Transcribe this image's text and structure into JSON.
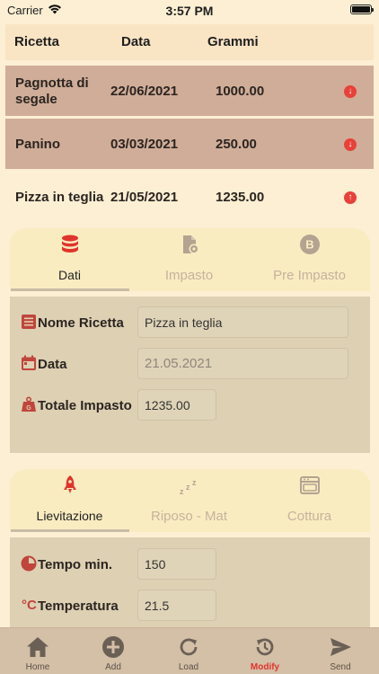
{
  "status_bar": {
    "carrier": "Carrier",
    "time": "3:57 PM"
  },
  "table": {
    "headers": {
      "recipe": "Ricetta",
      "date": "Data",
      "grams": "Grammi"
    },
    "rows": [
      {
        "name": "Pagnotta di segale",
        "date": "22/06/2021",
        "grams": "1000.00",
        "arrow": "↓"
      },
      {
        "name": "Panino",
        "date": "03/03/2021",
        "grams": "250.00",
        "arrow": "↓"
      },
      {
        "name": "Pizza in teglia",
        "date": "21/05/2021",
        "grams": "1235.00",
        "arrow": "↑"
      }
    ]
  },
  "card1": {
    "tabs": [
      {
        "label": "Dati",
        "icon": "database-icon",
        "active": true
      },
      {
        "label": "Impasto",
        "icon": "document-gear-icon",
        "active": false
      },
      {
        "label": "Pre Impasto",
        "icon": "circle-b-icon",
        "active": false
      }
    ],
    "fields": {
      "name_label": "Nome Ricetta",
      "name_value": "Pizza in teglia",
      "date_label": "Data",
      "date_value": "21.05.2021",
      "total_label": "Totale Impasto",
      "total_value": "1235.00"
    }
  },
  "card2": {
    "tabs": [
      {
        "label": "Lievitazione",
        "icon": "rocket-icon",
        "active": true
      },
      {
        "label": "Riposo - Mat",
        "icon": "zzz-icon",
        "active": false
      },
      {
        "label": "Cottura",
        "icon": "oven-icon",
        "active": false
      }
    ],
    "fields": {
      "time_label": "Tempo min.",
      "time_value": "150",
      "temp_label": "Temperatura",
      "temp_value": "21.5",
      "temp_unit_symbol": "°C"
    }
  },
  "tab_bar": {
    "items": [
      {
        "label": "Home",
        "icon": "home-icon",
        "active": false
      },
      {
        "label": "Add",
        "icon": "add-icon",
        "active": false
      },
      {
        "label": "Load",
        "icon": "load-icon",
        "active": false
      },
      {
        "label": "Modify",
        "icon": "modify-icon",
        "active": true
      },
      {
        "label": "Send",
        "icon": "send-icon",
        "active": false
      }
    ]
  },
  "colors": {
    "background": "#fcefd3",
    "row_dark": "#d0ad98",
    "accent_red": "#e0342c",
    "icon_red": "#c0453c",
    "card_tabs_bg": "#faecc1",
    "card_body_bg": "#ddd0b3",
    "tab_bar_bg": "#d4bfa7"
  }
}
